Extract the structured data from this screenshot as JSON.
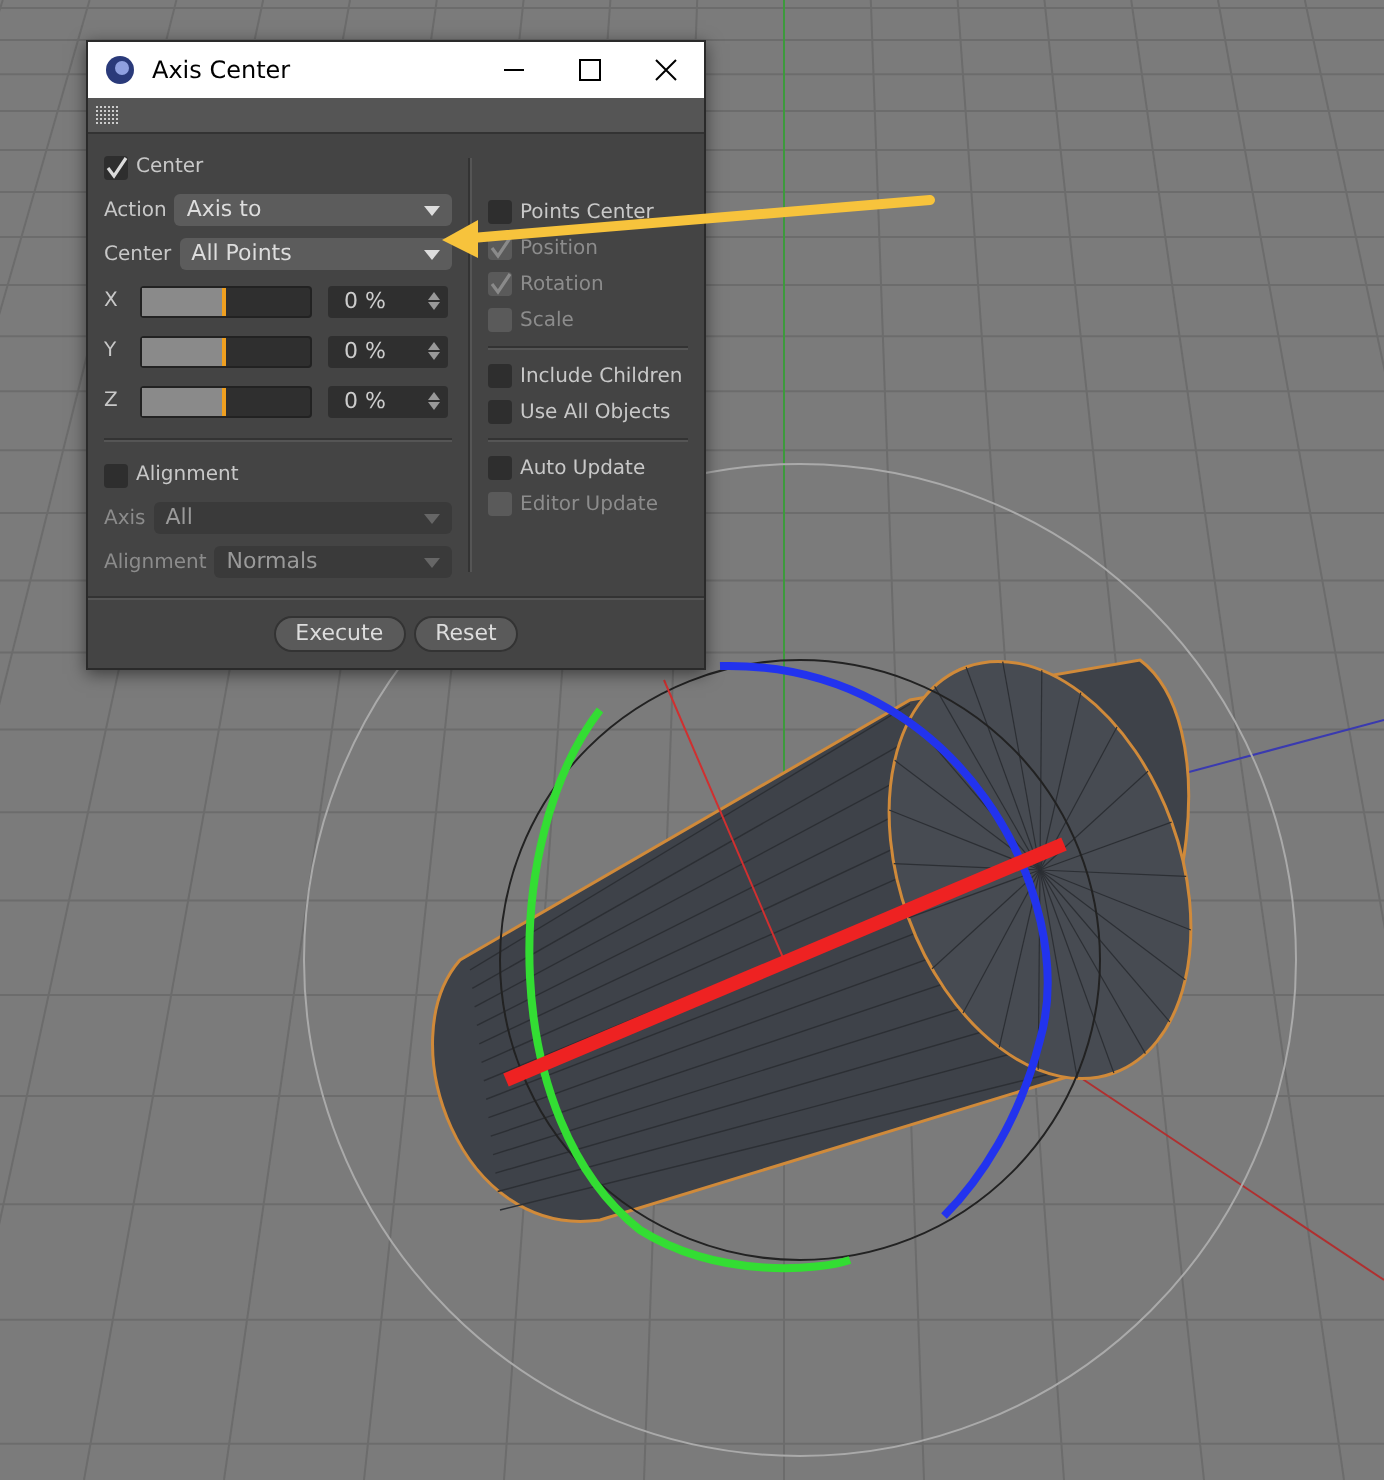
{
  "window": {
    "title": "Axis Center"
  },
  "left": {
    "center": {
      "label": "Center",
      "checked": true
    },
    "action": {
      "label": "Action",
      "value": "Axis to",
      "disabled": false
    },
    "center_mode": {
      "label": "Center",
      "value": "All Points",
      "disabled": false
    },
    "sliders": [
      {
        "axis": "X",
        "level": 0.5,
        "reading": "0 %"
      },
      {
        "axis": "Y",
        "level": 0.5,
        "reading": "0 %"
      },
      {
        "axis": "Z",
        "level": 0.5,
        "reading": "0 %"
      }
    ],
    "alignment": {
      "label": "Alignment",
      "checked": false
    },
    "axis": {
      "label": "Axis",
      "value": "All",
      "disabled": true
    },
    "alignment_mode": {
      "label": "Alignment",
      "value": "Normals",
      "disabled": true
    }
  },
  "right_groups": [
    [
      {
        "label": "Points Center",
        "checked": false,
        "disabled": false
      },
      {
        "label": "Position",
        "checked": true,
        "disabled": true
      },
      {
        "label": "Rotation",
        "checked": true,
        "disabled": true
      },
      {
        "label": "Scale",
        "checked": false,
        "disabled": true
      }
    ],
    [
      {
        "label": "Include Children",
        "checked": false,
        "disabled": false
      },
      {
        "label": "Use All Objects",
        "checked": false,
        "disabled": false
      }
    ],
    [
      {
        "label": "Auto Update",
        "checked": false,
        "disabled": false
      },
      {
        "label": "Editor Update",
        "checked": false,
        "disabled": true
      }
    ]
  ],
  "buttons": [
    "Execute",
    "Reset"
  ]
}
